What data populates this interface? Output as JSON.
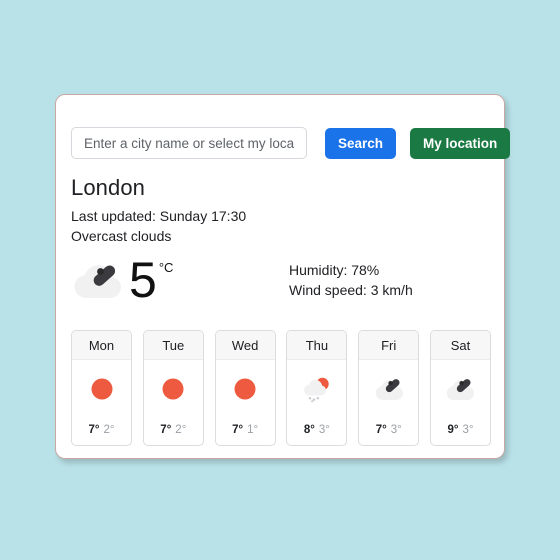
{
  "theme": {
    "page_background": "#b9e2e8",
    "card_background": "#ffffff",
    "card_border": "#c9a8a4",
    "search_button_color": "#1a73e8",
    "location_button_color": "#1b7a43",
    "sun_color": "#ee5a3f",
    "cloud_color": "#f1f1f1",
    "text_color": "#202124",
    "muted_text_color": "#9aa0a6"
  },
  "search": {
    "placeholder": "Enter a city name or select my location",
    "value": "",
    "search_label": "Search",
    "my_location_label": "My location"
  },
  "current": {
    "city": "London",
    "last_updated": "Last updated: Sunday 17:30",
    "description": "Overcast clouds",
    "temperature": "5",
    "unit": "°C",
    "icon": "cloud-icon",
    "humidity": "Humidity: 78%",
    "wind_speed": "Wind speed: 3 km/h"
  },
  "forecast": [
    {
      "day": "Mon",
      "icon": "sun-icon",
      "max": "7°",
      "min": "2°"
    },
    {
      "day": "Tue",
      "icon": "sun-icon",
      "max": "7°",
      "min": "2°"
    },
    {
      "day": "Wed",
      "icon": "sun-icon",
      "max": "7°",
      "min": "1°"
    },
    {
      "day": "Thu",
      "icon": "sun-rain-cloud-icon",
      "max": "8°",
      "min": "3°"
    },
    {
      "day": "Fri",
      "icon": "cloud-icon",
      "max": "7°",
      "min": "3°"
    },
    {
      "day": "Sat",
      "icon": "cloud-icon",
      "max": "9°",
      "min": "3°"
    }
  ]
}
